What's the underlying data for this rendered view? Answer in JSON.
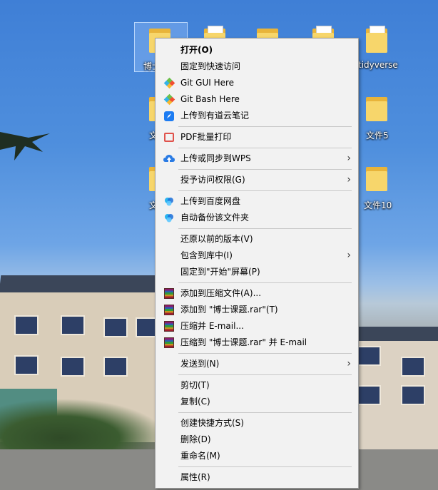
{
  "desktop": {
    "icons": [
      {
        "label": "博士"
      },
      {
        "label": ""
      },
      {
        "label": ""
      },
      {
        "label": ""
      },
      {
        "label": "tidyverse"
      },
      {
        "label": "文"
      },
      {
        "label": "文件5"
      },
      {
        "label": "文"
      },
      {
        "label": "文件10"
      }
    ]
  },
  "menu": {
    "items": [
      {
        "label": "打开(O)",
        "icon": "none"
      },
      {
        "label": "固定到快速访问",
        "icon": "none"
      },
      {
        "label": "Git GUI Here",
        "icon": "git-icon"
      },
      {
        "label": "Git Bash Here",
        "icon": "git-icon"
      },
      {
        "label": "上传到有道云笔记",
        "icon": "youdao-note-icon"
      },
      {
        "label": "PDF批量打印",
        "icon": "printer-icon"
      },
      {
        "label": "上传或同步到WPS",
        "icon": "wps-cloud-icon"
      },
      {
        "label": "授予访问权限(G)",
        "icon": "none"
      },
      {
        "label": "上传到百度网盘",
        "icon": "baidu-netdisk-icon"
      },
      {
        "label": "自动备份该文件夹",
        "icon": "baidu-netdisk-icon"
      },
      {
        "label": "还原以前的版本(V)",
        "icon": "none"
      },
      {
        "label": "包含到库中(I)",
        "icon": "none"
      },
      {
        "label": "固定到\"开始\"屏幕(P)",
        "icon": "none"
      },
      {
        "label": "添加到压缩文件(A)...",
        "icon": "winrar-icon"
      },
      {
        "label": "添加到 \"博士课题.rar\"(T)",
        "icon": "winrar-icon"
      },
      {
        "label": "压缩并 E-mail...",
        "icon": "winrar-icon"
      },
      {
        "label": "压缩到 \"博士课题.rar\" 并 E-mail",
        "icon": "winrar-icon"
      },
      {
        "label": "发送到(N)",
        "icon": "none"
      },
      {
        "label": "剪切(T)",
        "icon": "none"
      },
      {
        "label": "复制(C)",
        "icon": "none"
      },
      {
        "label": "创建快捷方式(S)",
        "icon": "none"
      },
      {
        "label": "删除(D)",
        "icon": "none"
      },
      {
        "label": "重命名(M)",
        "icon": "none"
      },
      {
        "label": "属性(R)",
        "icon": "none"
      }
    ],
    "submenu_arrow": "›"
  },
  "colors": {
    "menu_bg": "#f2f2f2",
    "menu_border": "#a0a0a0",
    "separator": "#c8c8c8",
    "folder": "#f7d66b"
  }
}
